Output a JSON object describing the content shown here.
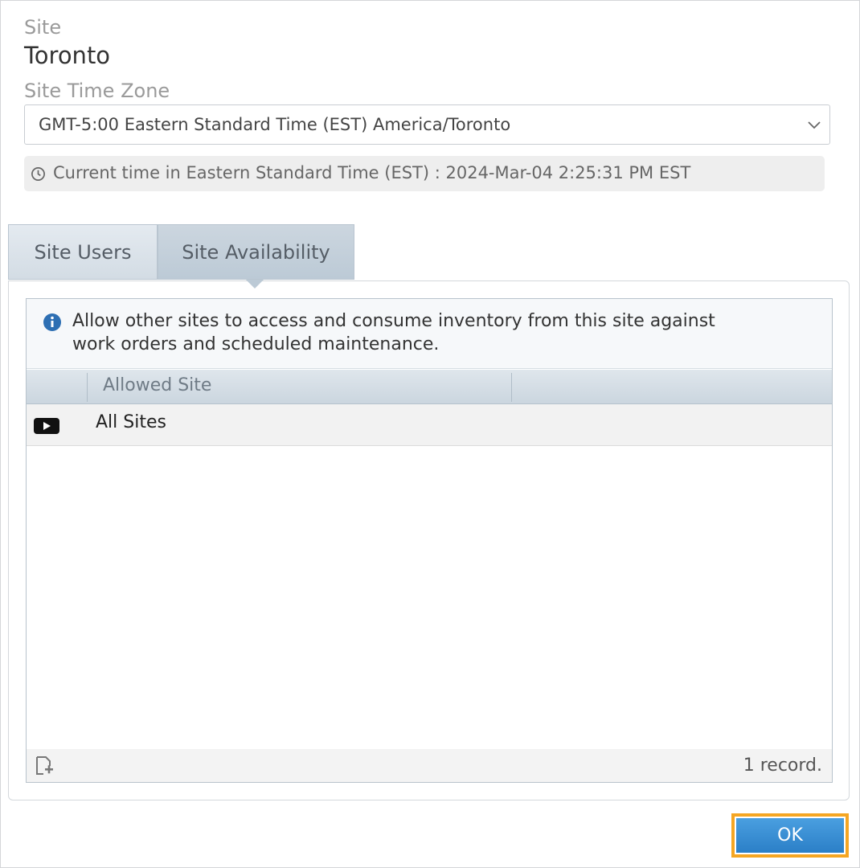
{
  "site": {
    "label": "Site",
    "value": "Toronto"
  },
  "timezone": {
    "label": "Site Time Zone",
    "selected": "GMT-5:00 Eastern Standard Time (EST) America/Toronto",
    "current_time": "Current time in Eastern Standard Time (EST) : 2024-Mar-04 2:25:31 PM EST"
  },
  "tabs": [
    {
      "label": "Site Users",
      "active": false
    },
    {
      "label": "Site Availability",
      "active": true
    }
  ],
  "availability": {
    "info": "Allow other sites to access and consume inventory from this site against work orders and scheduled maintenance.",
    "columns": [
      "Allowed Site"
    ],
    "rows": [
      {
        "allowed_site": "All Sites"
      }
    ],
    "record_count": "1 record."
  },
  "footer": {
    "ok_label": "OK"
  },
  "colors": {
    "accent": "#2b7fc7",
    "focus_outline": "#f5a623"
  }
}
